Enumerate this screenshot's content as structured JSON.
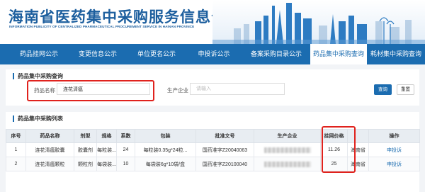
{
  "header": {
    "title": "海南省医药集中采购服务信息公示",
    "subtitle": "INFORMATION PUBLICITY OF CENTRALIZED PHARMACEUTICAL PROCUREMENT SERVICE IN HAINAN PROVINCE"
  },
  "nav": {
    "items": [
      {
        "label": "药品挂网公示"
      },
      {
        "label": "变更信息公示"
      },
      {
        "label": "单位更名公示"
      },
      {
        "label": "申投诉公示"
      },
      {
        "label": "备案采购目录公示"
      },
      {
        "label": "药品集中采购查询"
      },
      {
        "label": "耗材集中采购查询"
      }
    ],
    "active_index": 5
  },
  "query": {
    "title": "药品集中采购查询",
    "drug_name_label": "药品名称",
    "drug_name_value": "连花清瘟",
    "manufacturer_label": "生产企业",
    "manufacturer_placeholder": "请输入",
    "search_button": "查询",
    "reset_button": "重置"
  },
  "list": {
    "title": "药品集中采购列表",
    "columns": [
      "序号",
      "药品名称",
      "剂型",
      "规格",
      "系数",
      "包装",
      "批准文号",
      "生产企业",
      "挂网价格",
      "操作"
    ],
    "rows": [
      {
        "index": "1",
        "name": "连花清瘟胶囊",
        "form": "胶囊剂",
        "spec": "每粒装...",
        "factor": "24",
        "package": "每粒装0.35g*24粒...",
        "approval": "国药准字Z20040063",
        "price": "11.26",
        "region": "海南省",
        "action": "申投诉"
      },
      {
        "index": "2",
        "name": "连花清瘟颗粒",
        "form": "颗粒剂",
        "spec": "每袋装...",
        "factor": "10",
        "package": "每袋装6g*10袋/盒",
        "approval": "国药准字Z20100040",
        "price": "25",
        "region": "海南省",
        "action": "申投诉"
      }
    ]
  },
  "colors": {
    "brand_blue": "#1b6cb0",
    "highlight_red": "#e0221d"
  }
}
